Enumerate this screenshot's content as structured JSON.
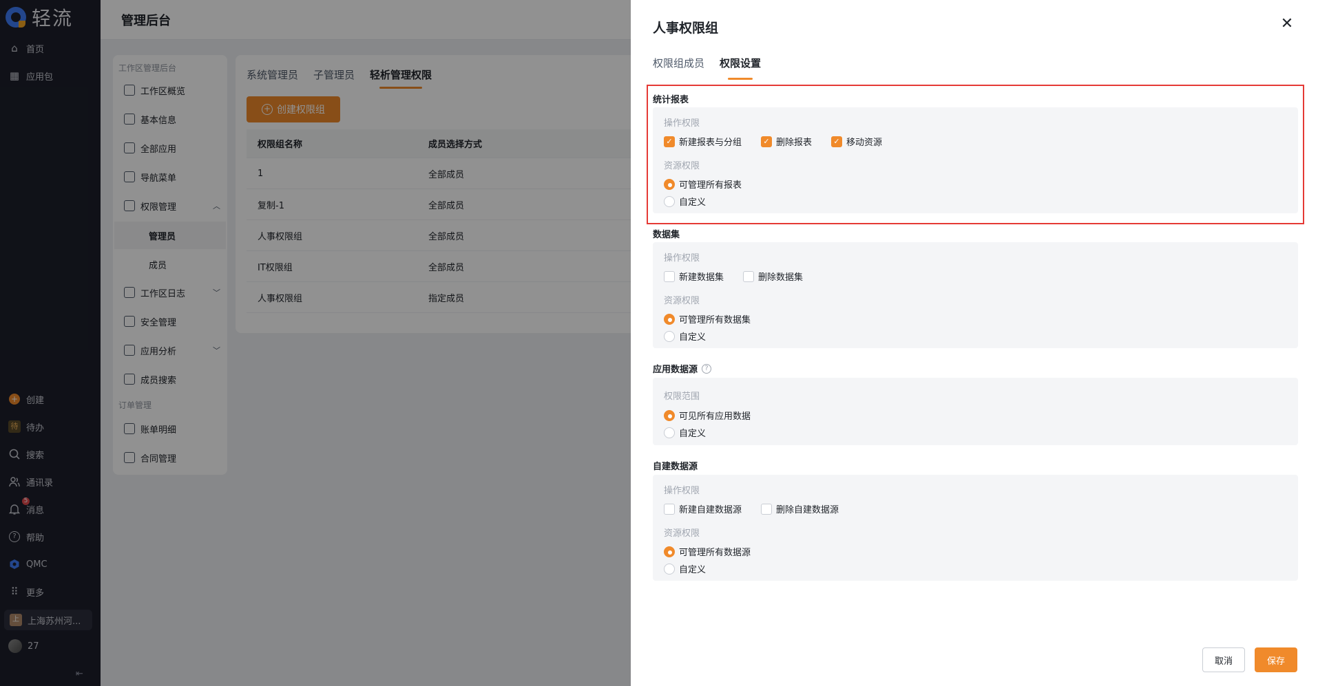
{
  "nav": {
    "brand": "轻流",
    "top_items": [
      {
        "label": "首页",
        "icon": "home-icon"
      },
      {
        "label": "应用包",
        "icon": "grid-icon"
      }
    ],
    "bottom_items": [
      {
        "label": "创建",
        "icon": "plus-icon"
      },
      {
        "label": "待办",
        "icon": "todo-icon",
        "icon_text": "待"
      },
      {
        "label": "搜索",
        "icon": "search-icon"
      },
      {
        "label": "通讯录",
        "icon": "contacts-icon"
      },
      {
        "label": "消息",
        "icon": "bell-icon",
        "badge": "5"
      },
      {
        "label": "帮助",
        "icon": "help-icon"
      },
      {
        "label": "QMC",
        "icon": "qmc-icon"
      },
      {
        "label": "更多",
        "icon": "apps-icon"
      }
    ],
    "org": {
      "label": "上海苏州河...",
      "icon_text": "上"
    },
    "user": {
      "label": "27"
    }
  },
  "admin": {
    "title": "管理后台",
    "menu_group_1": "工作区管理后台",
    "menu": [
      {
        "label": "工作区概览"
      },
      {
        "label": "基本信息"
      },
      {
        "label": "全部应用"
      },
      {
        "label": "导航菜单"
      },
      {
        "label": "权限管理"
      },
      {
        "label": "工作区日志"
      },
      {
        "label": "安全管理"
      },
      {
        "label": "应用分析"
      },
      {
        "label": "成员搜索"
      }
    ],
    "submenu": [
      {
        "label": "管理员"
      },
      {
        "label": "成员"
      }
    ],
    "menu_group_2": "订单管理",
    "menu2": [
      {
        "label": "账单明细"
      },
      {
        "label": "合同管理"
      }
    ],
    "tabs": [
      "系统管理员",
      "子管理员",
      "轻析管理权限"
    ],
    "create_button": "创建权限组",
    "table": {
      "headers": [
        "权限组名称",
        "成员选择方式"
      ],
      "rows": [
        [
          "1",
          "全部成员"
        ],
        [
          "复制-1",
          "全部成员"
        ],
        [
          "人事权限组",
          "全部成员"
        ],
        [
          "IT权限组",
          "全部成员"
        ],
        [
          "人事权限组",
          "指定成员"
        ]
      ]
    }
  },
  "drawer": {
    "title": "人事权限组",
    "tabs": [
      "权限组成员",
      "权限设置"
    ],
    "sections": {
      "report": {
        "title": "统计报表",
        "op_label": "操作权限",
        "ops": [
          "新建报表与分组",
          "删除报表",
          "移动资源"
        ],
        "res_label": "资源权限",
        "res": [
          "可管理所有报表",
          "自定义"
        ]
      },
      "dataset": {
        "title": "数据集",
        "op_label": "操作权限",
        "ops": [
          "新建数据集",
          "删除数据集"
        ],
        "res_label": "资源权限",
        "res": [
          "可管理所有数据集",
          "自定义"
        ]
      },
      "appsource": {
        "title": "应用数据源",
        "scope_label": "权限范围",
        "res": [
          "可见所有应用数据",
          "自定义"
        ]
      },
      "customsource": {
        "title": "自建数据源",
        "op_label": "操作权限",
        "ops": [
          "新建自建数据源",
          "删除自建数据源"
        ],
        "res_label": "资源权限",
        "res": [
          "可管理所有数据源",
          "自定义"
        ]
      }
    },
    "cancel": "取消",
    "save": "保存"
  },
  "colors": {
    "accent": "#f08a2b",
    "highlight": "#e53935",
    "nav_bg": "#1d1f2b"
  }
}
